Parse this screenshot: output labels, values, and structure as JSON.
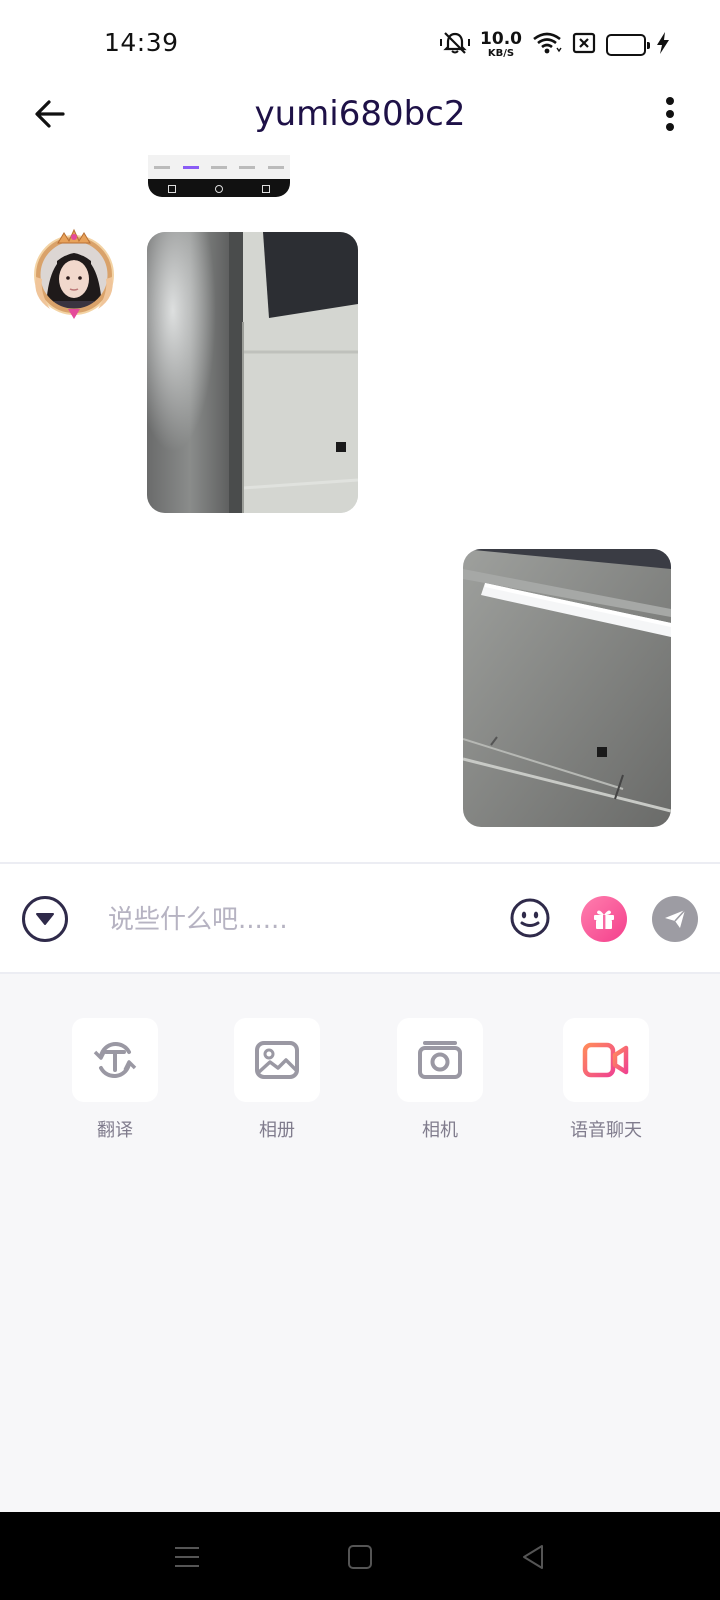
{
  "status_bar": {
    "time": "14:39",
    "net_speed_value": "10.0",
    "net_speed_unit": "KB/S",
    "icons": [
      "mute-vibrate-icon",
      "wifi-icon",
      "no-sim-icon",
      "battery-icon",
      "charging-icon"
    ],
    "battery_level": 1.0,
    "battery_color": "#f5d66b"
  },
  "header": {
    "title": "yumi680bc2",
    "back_icon": "arrow-left-icon",
    "menu_icon": "more-vertical-icon",
    "title_color": "#1e1147"
  },
  "messages": [
    {
      "type": "image",
      "side": "left",
      "partial": true
    },
    {
      "type": "image",
      "side": "left",
      "sender": "yumi680bc2",
      "has_avatar": true
    },
    {
      "type": "image",
      "side": "right"
    }
  ],
  "composer": {
    "placeholder": "说些什么吧......",
    "value": "",
    "icons": [
      "chevron-down-circle-icon",
      "emoji-icon",
      "gift-icon",
      "send-icon"
    ],
    "gift_color": "#f43f8c",
    "send_color": "#9d9ca3"
  },
  "tools": [
    {
      "label": "翻译",
      "icon": "translate-icon"
    },
    {
      "label": "相册",
      "icon": "album-icon"
    },
    {
      "label": "相机",
      "icon": "camera-icon"
    },
    {
      "label": "语音聊天",
      "icon": "video-call-icon",
      "color": "#f34e8e"
    }
  ],
  "nav_bar": {
    "buttons": [
      "menu-icon",
      "home-icon",
      "back-triangle-icon"
    ]
  }
}
